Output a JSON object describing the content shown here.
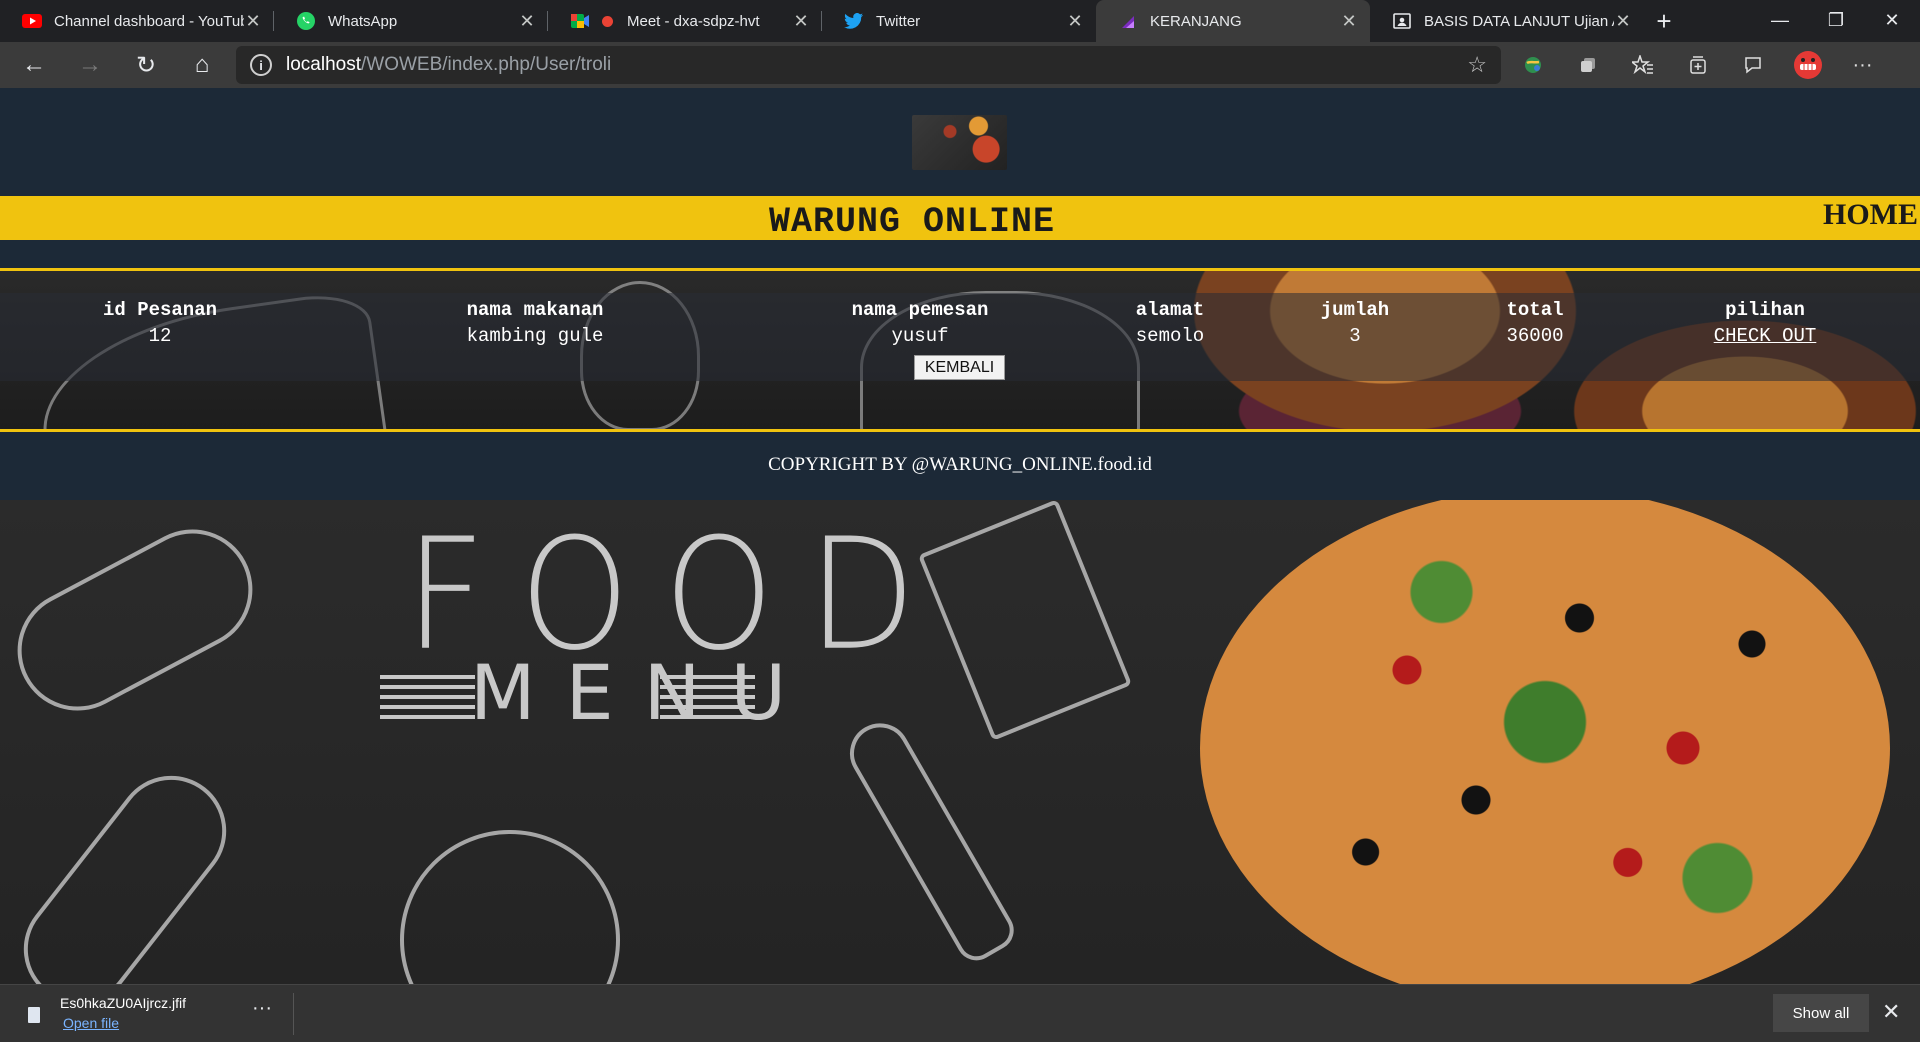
{
  "browser": {
    "tabs": [
      {
        "title": "Channel dashboard - YouTube",
        "icon": "youtube-icon",
        "color": "#ff0000",
        "active": false
      },
      {
        "title": "WhatsApp",
        "icon": "whatsapp-icon",
        "color": "#25d366",
        "active": false
      },
      {
        "title": "Meet - dxa-sdpz-hvt",
        "icon": "meet-icon",
        "color": "#00ac47",
        "active": false
      },
      {
        "title": "Twitter",
        "icon": "twitter-icon",
        "color": "#1da1f2",
        "active": false
      },
      {
        "title": "KERANJANG",
        "icon": "page-icon",
        "color": "#7b2cbf",
        "active": true
      },
      {
        "title": "BASIS DATA LANJUT Ujian Akhir",
        "icon": "classroom-icon",
        "color": "#e8eaed",
        "active": false
      }
    ],
    "url_host": "localhost",
    "url_path": "/WOWEB/index.php/User/troli"
  },
  "site": {
    "title": "WARUNG ONLINE",
    "home_link": "HOME",
    "copyright": "COPYRIGHT BY @WARUNG_ONLINE.food.id"
  },
  "cart": {
    "headers": {
      "id": "id Pesanan",
      "food": "nama makanan",
      "customer": "nama pemesan",
      "address": "alamat",
      "qty": "jumlah",
      "total": "total",
      "action": "pilihan"
    },
    "row": {
      "id": "12",
      "food": "kambing gule",
      "customer": "yusuf",
      "address": "semolo",
      "qty": "3",
      "total": "36000",
      "action": "CHECK OUT"
    },
    "back_button": "KEMBALI"
  },
  "hero": {
    "food_text": "FOOD",
    "menu_text": "MENU"
  },
  "downloads": {
    "file_name": "Es0hkaZU0AIjrcz.jfif",
    "open_label": "Open file",
    "more": "···",
    "show_all": "Show all",
    "close": "✕"
  }
}
